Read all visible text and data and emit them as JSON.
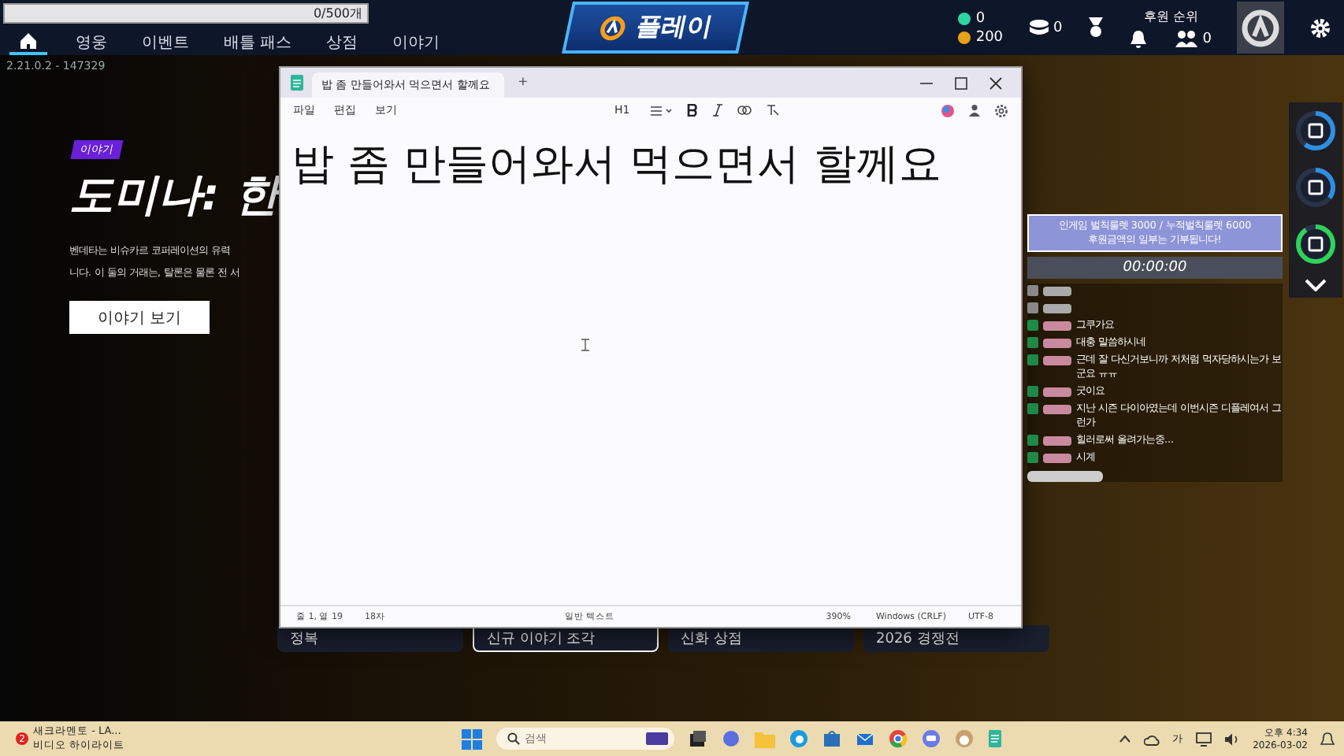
{
  "progress_bar": {
    "count": "0/500개",
    "level": 0.0
  },
  "top_nav": {
    "items": [
      {
        "label": "영웅",
        "selected": false
      },
      {
        "label": "이벤트",
        "selected": false
      },
      {
        "label": "배틀 패스",
        "selected": false
      },
      {
        "label": "상점",
        "selected": false
      },
      {
        "label": "이야기",
        "selected": false
      }
    ],
    "home_selected": true,
    "logo": "플레이",
    "currencies": [
      {
        "value": "0"
      },
      {
        "value": "200"
      }
    ],
    "stack_count": "0",
    "ranking_label": "후원 순위",
    "friends_count": "0"
  },
  "version": "2.21.0.2 - 147329",
  "story": {
    "tag": "이야기",
    "title": "도미나: 한",
    "description": [
      "벤데타는 비슈카르 코퍼레이션의 유력",
      "니다. 이 둘의 거래는, 탈론은 물론 전 서"
    ],
    "button": "이야기 보기"
  },
  "notepad": {
    "tab": "밥 좀 만들어와서 먹으면서 할께요",
    "add_tab": "+",
    "menus": [
      "파일",
      "편집",
      "보기"
    ],
    "heading_menu": "H1",
    "content": "밥 좀 만들어와서 먹으면서 할께요",
    "status": [
      "줄 1, 열 19",
      "18자",
      "일반 텍스트",
      "390%",
      "Windows (CRLF)",
      "UTF-8"
    ]
  },
  "donation": {
    "lines": [
      "인게임 벌칙룰렛 3000 / 누적벌칙룰렛 6000",
      "후원금액의 일부는 기부됩니다!"
    ],
    "timer": "00:00:00"
  },
  "chat": [
    {
      "faded": true
    },
    {
      "faded": true
    },
    {
      "message": "그쿠가요",
      "faded": false
    },
    {
      "message": "대충 말씀하시네",
      "faded": false
    },
    {
      "message": "근데 잘 다신거보니까 저처럼 먹자당하시는가 보군요 ㅠㅠ",
      "faded": false
    },
    {
      "message": "굿이요",
      "faded": false
    },
    {
      "message": "지난 시즌 다이아였는데 이번시즌 디플레여서 그런가",
      "faded": false
    },
    {
      "message": "힐러로써 올려가는중...",
      "faded": false
    },
    {
      "message": "시계",
      "faded": false
    }
  ],
  "side_rings": [
    {
      "level": 0.6
    },
    {
      "level": 0.35
    },
    {
      "level": 0.9
    }
  ],
  "cards": [
    {
      "label": "정복",
      "selected": false
    },
    {
      "label": "신규 이야기 조각",
      "selected": true
    },
    {
      "label": "신화 상점",
      "selected": false
    },
    {
      "label": "2026 경쟁전",
      "selected": false
    }
  ],
  "taskbar": {
    "notification": {
      "badge": "2",
      "title": "새크라멘토 - LA...",
      "subtitle": "비디오 하이라이트"
    },
    "search": {
      "placeholder": "검색"
    },
    "ime": "가",
    "time": "오후 4:34",
    "date": "2026-03-02"
  }
}
